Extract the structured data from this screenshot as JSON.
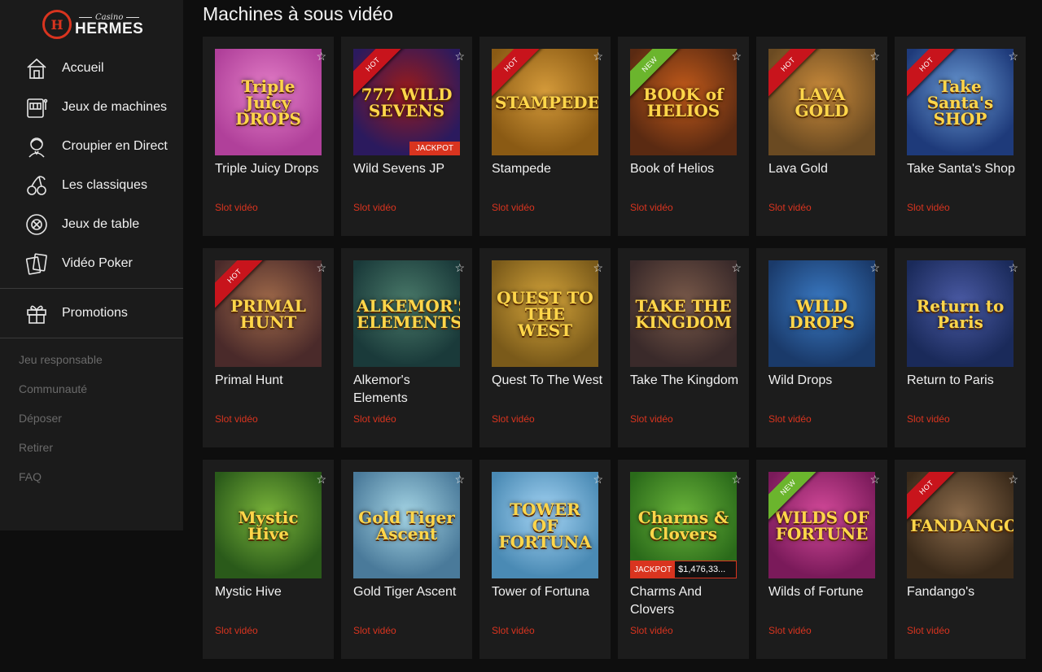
{
  "brand": {
    "small": "Casino",
    "big": "HERMES",
    "mark": "H"
  },
  "nav": [
    {
      "label": "Accueil",
      "icon": "home-icon"
    },
    {
      "label": "Jeux de machines",
      "icon": "slot-machine-icon"
    },
    {
      "label": "Croupier en Direct",
      "icon": "dealer-icon"
    },
    {
      "label": "Les classiques",
      "icon": "cherries-icon"
    },
    {
      "label": "Jeux de table",
      "icon": "chip-icon"
    },
    {
      "label": "Vidéo Poker",
      "icon": "cards-icon"
    }
  ],
  "promo": {
    "label": "Promotions",
    "icon": "gift-icon"
  },
  "secondary": [
    "Jeu responsable",
    "Communauté",
    "Déposer",
    "Retirer",
    "FAQ"
  ],
  "page_title": "Machines à sous vidéo",
  "games": [
    {
      "name": "Triple Juicy Drops",
      "type": "Slot vidéo",
      "badge": "",
      "art": "Triple Juicy DROPS",
      "bg": "#b0409a",
      "bg2": "#e47fc8"
    },
    {
      "name": "Wild Sevens JP",
      "type": "Slot vidéo",
      "badge": "HOT",
      "art": "777 WILD SEVENS",
      "bg": "#2b1a5e",
      "bg2": "#9a1b1b",
      "jackpot_tag": "JACKPOT"
    },
    {
      "name": "Stampede",
      "type": "Slot vidéo",
      "badge": "HOT",
      "art": "STAMPEDE",
      "bg": "#8a5a14",
      "bg2": "#d49a3a"
    },
    {
      "name": "Book of Helios",
      "type": "Slot vidéo",
      "badge": "NEW",
      "art": "BOOK of HELIOS",
      "bg": "#5a2a12",
      "bg2": "#c25a1a"
    },
    {
      "name": "Lava Gold",
      "type": "Slot vidéo",
      "badge": "HOT",
      "art": "LAVA GOLD",
      "bg": "#6a4a22",
      "bg2": "#c98a3a"
    },
    {
      "name": "Take Santa's Shop",
      "type": "Slot vidéo",
      "badge": "HOT",
      "art": "Take Santa's SHOP",
      "bg": "#1e3a7a",
      "bg2": "#6a9ad4"
    },
    {
      "name": "Primal Hunt",
      "type": "Slot vidéo",
      "badge": "HOT",
      "art": "PRIMAL HUNT",
      "bg": "#4a2a2a",
      "bg2": "#a06a4a"
    },
    {
      "name": "Alkemor's Elements",
      "type": "Slot vidéo",
      "badge": "",
      "art": "ALKEMOR'S ELEMENTS",
      "bg": "#1a3a3a",
      "bg2": "#4a7a6a"
    },
    {
      "name": "Quest To The West",
      "type": "Slot vidéo",
      "badge": "",
      "art": "QUEST TO THE WEST",
      "bg": "#7a5a1a",
      "bg2": "#d4a43a"
    },
    {
      "name": "Take The Kingdom",
      "type": "Slot vidéo",
      "badge": "",
      "art": "TAKE THE KINGDOM",
      "bg": "#3a2a2a",
      "bg2": "#7a5a4a"
    },
    {
      "name": "Wild Drops",
      "type": "Slot vidéo",
      "badge": "",
      "art": "WILD DROPS",
      "bg": "#1a3a6a",
      "bg2": "#3a7ac4"
    },
    {
      "name": "Return to Paris",
      "type": "Slot vidéo",
      "badge": "",
      "art": "Return to Paris",
      "bg": "#1a2a5a",
      "bg2": "#4a5aa4"
    },
    {
      "name": "Mystic Hive",
      "type": "Slot vidéo",
      "badge": "",
      "art": "Mystic Hive",
      "bg": "#2a5a1a",
      "bg2": "#7ab43a"
    },
    {
      "name": "Gold Tiger Ascent",
      "type": "Slot vidéo",
      "badge": "",
      "art": "Gold Tiger Ascent",
      "bg": "#4a7a9a",
      "bg2": "#a4d4e4"
    },
    {
      "name": "Tower of Fortuna",
      "type": "Slot vidéo",
      "badge": "",
      "art": "TOWER OF FORTUNA",
      "bg": "#4a8ab4",
      "bg2": "#a4d4f4"
    },
    {
      "name": "Charms And Clovers",
      "type": "Slot vidéo",
      "badge": "",
      "art": "Charms & Clovers",
      "bg": "#2a6a1a",
      "bg2": "#6ab43a",
      "jackpot_label": "JACKPOT",
      "jackpot_amount": "$1,476,33..."
    },
    {
      "name": "Wilds of Fortune",
      "type": "Slot vidéo",
      "badge": "NEW",
      "art": "WILDS OF FORTUNE",
      "bg": "#7a1a5a",
      "bg2": "#d44a9a"
    },
    {
      "name": "Fandango's",
      "type": "Slot vidéo",
      "badge": "HOT",
      "art": "FANDANGO'S",
      "bg": "#3a2a1a",
      "bg2": "#8a6a4a"
    }
  ]
}
